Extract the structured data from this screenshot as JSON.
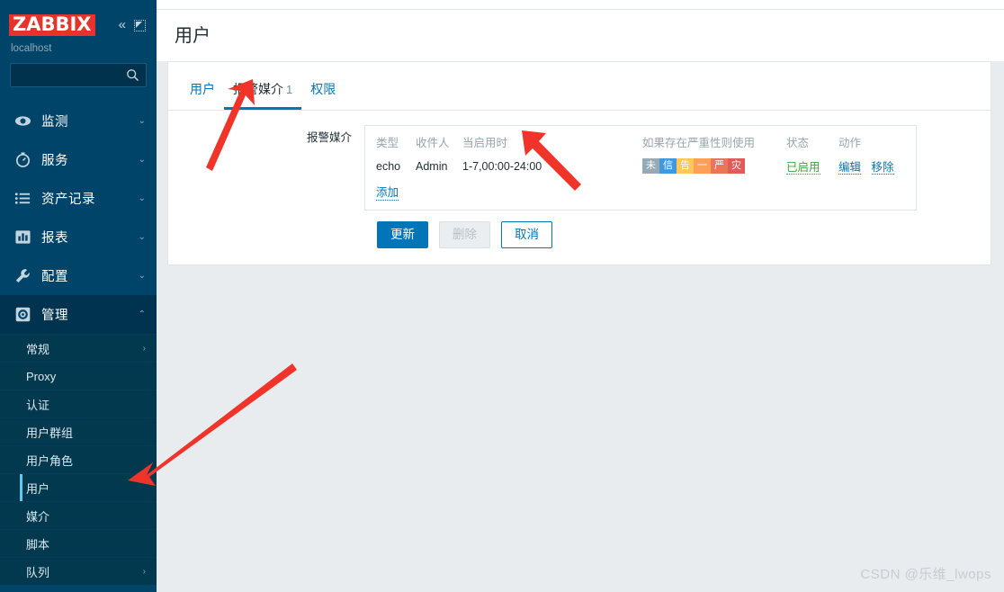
{
  "brand": {
    "logo_text": "ZABBIX",
    "host": "localhost",
    "logo_bg": "#e8332c",
    "collapse_icon": "double-chevron-left-icon",
    "compact_icon": "compact-view-icon"
  },
  "search": {
    "value": "",
    "placeholder": "",
    "icon": "search-icon"
  },
  "sidebar": {
    "items": [
      {
        "label": "监测",
        "icon": "eye-icon",
        "chevron": "⌄",
        "expanded": false
      },
      {
        "label": "服务",
        "icon": "stopwatch-icon",
        "chevron": "⌄",
        "expanded": false
      },
      {
        "label": "资产记录",
        "icon": "list-icon",
        "chevron": "⌄",
        "expanded": false
      },
      {
        "label": "报表",
        "icon": "chart-icon",
        "chevron": "⌄",
        "expanded": false
      },
      {
        "label": "配置",
        "icon": "wrench-icon",
        "chevron": "⌄",
        "expanded": false
      },
      {
        "label": "管理",
        "icon": "gear-icon",
        "chevron": "⌃",
        "expanded": true
      }
    ],
    "submenu": [
      {
        "label": "常规",
        "chevron": "›",
        "active": false
      },
      {
        "label": "Proxy",
        "chevron": "",
        "active": false
      },
      {
        "label": "认证",
        "chevron": "",
        "active": false
      },
      {
        "label": "用户群组",
        "chevron": "",
        "active": false
      },
      {
        "label": "用户角色",
        "chevron": "",
        "active": false
      },
      {
        "label": "用户",
        "chevron": "",
        "active": true
      },
      {
        "label": "媒介",
        "chevron": "",
        "active": false
      },
      {
        "label": "脚本",
        "chevron": "",
        "active": false
      },
      {
        "label": "队列",
        "chevron": "›",
        "active": false
      }
    ]
  },
  "page": {
    "title": "用户"
  },
  "tabs": [
    {
      "label": "用户",
      "count": "",
      "active": false
    },
    {
      "label": "报警媒介",
      "count": "1",
      "active": true
    },
    {
      "label": "权限",
      "count": "",
      "active": false
    }
  ],
  "form": {
    "media_label": "报警媒介",
    "columns": [
      "类型",
      "收件人",
      "当启用时",
      "如果存在严重性则使用",
      "状态",
      "动作"
    ],
    "rows": [
      {
        "type": "echo",
        "recipient": "Admin",
        "when": "1-7,00:00-24:00",
        "severities": [
          {
            "label": "未",
            "color": "#97aab3"
          },
          {
            "label": "信",
            "color": "#4298dc"
          },
          {
            "label": "告",
            "color": "#ffc859"
          },
          {
            "label": "一",
            "color": "#ffa059"
          },
          {
            "label": "严",
            "color": "#e97659"
          },
          {
            "label": "灾",
            "color": "#e45959"
          }
        ],
        "status": "已启用",
        "actions": [
          "编辑",
          "移除"
        ]
      }
    ],
    "add_link": "添加",
    "buttons": [
      {
        "label": "更新",
        "style": "primary",
        "disabled": false
      },
      {
        "label": "删除",
        "style": "disabled",
        "disabled": true
      },
      {
        "label": "取消",
        "style": "ghost",
        "disabled": false
      }
    ]
  },
  "watermark": {
    "text": "CSDN @乐维_lwops"
  },
  "colors": {
    "sidebar_bg": "#004469",
    "submenu_bg": "#02394f",
    "accent_blue": "#0275b8",
    "active_marker": "#68c5ed",
    "page_bg": "#e9ecef",
    "green": "#429e47",
    "arrow_red": "#f0342a"
  }
}
